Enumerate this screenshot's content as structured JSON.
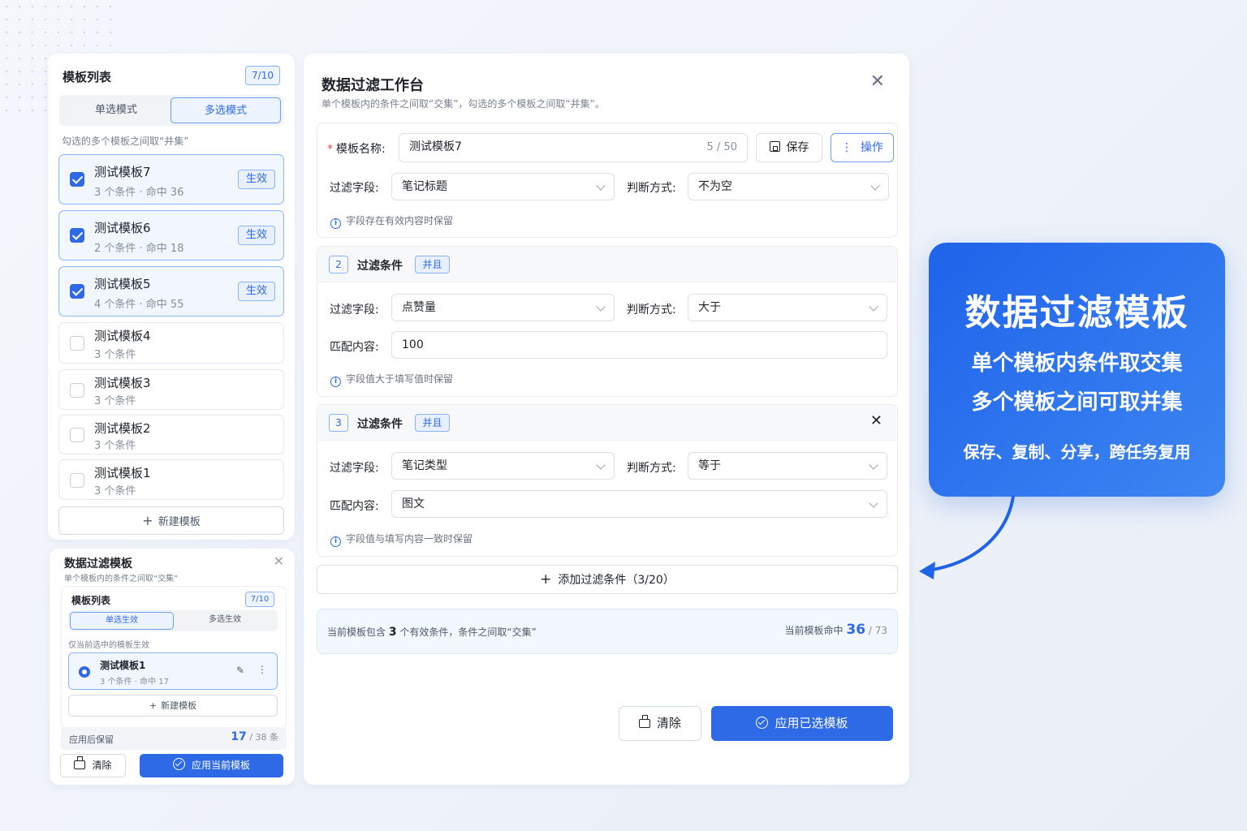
{
  "left_panel": {
    "title": "模板列表",
    "count": "7/10",
    "mode_single": "单选模式",
    "mode_multi": "多选模式",
    "hint": "勾选的多个模板之间取“并集”",
    "effective_label": "生效",
    "items": [
      {
        "name": "测试模板7",
        "meta": "3 个条件 · 命中 36",
        "checked": true
      },
      {
        "name": "测试模板6",
        "meta": "2 个条件 · 命中 18",
        "checked": true
      },
      {
        "name": "测试模板5",
        "meta": "4 个条件 · 命中 55",
        "checked": true
      },
      {
        "name": "测试模板4",
        "meta": "3 个条件",
        "checked": false
      },
      {
        "name": "测试模板3",
        "meta": "3 个条件",
        "checked": false
      },
      {
        "name": "测试模板2",
        "meta": "3 个条件",
        "checked": false
      },
      {
        "name": "测试模板1",
        "meta": "3 个条件",
        "checked": false
      }
    ],
    "new_template": "新建模板"
  },
  "mini_panel": {
    "title": "数据过滤模板",
    "subtitle": "单个模板内的条件之间取“交集”",
    "list_title": "模板列表",
    "count": "7/10",
    "mode_single": "单选生效",
    "mode_multi": "多选生效",
    "hint": "仅当前选中的模板生效",
    "item_name": "测试模板1",
    "item_meta": "3 个条件 · 命中 17",
    "new_template": "新建模板",
    "result_label": "应用后保留",
    "result_value": "17",
    "result_total": "/ 38 条",
    "clear": "清除",
    "apply": "应用当前模板"
  },
  "main_panel": {
    "title": "数据过滤工作台",
    "subtitle": "单个模板内的条件之间取“交集”，勾选的多个模板之间取“并集”。",
    "name_label": "模板名称:",
    "name_value": "测试模板7",
    "name_counter": "5 / 50",
    "save": "保存",
    "ops": "操作",
    "field_label": "过滤字段:",
    "method_label": "判断方式:",
    "match_label": "匹配内容:",
    "cond_title": "过滤条件",
    "and_label": "并且",
    "conditions": [
      {
        "field": "笔记标题",
        "method": "不为空",
        "tip": "字段存在有效内容时保留"
      },
      {
        "num": "2",
        "field": "点赞量",
        "method": "大于",
        "match": "100",
        "tip": "字段值大于填写值时保留"
      },
      {
        "num": "3",
        "field": "笔记类型",
        "method": "等于",
        "match": "图文",
        "tip": "字段值与填写内容一致时保留"
      }
    ],
    "add_condition": "添加过滤条件（3/20）",
    "summary_prefix": "当前模板包含",
    "summary_count": "3",
    "summary_suffix": "个有效条件，条件之间取“交集”",
    "hit_label": "当前模板命中",
    "hit_value": "36",
    "hit_total": "/ 73",
    "clear": "清除",
    "apply": "应用已选模板"
  },
  "promo": {
    "title": "数据过滤模板",
    "line1": "单个模板内条件取交集",
    "line2": "多个模板之间可取并集",
    "line3": "保存、复制、分享，跨任务复用"
  },
  "colors": {
    "accent": "#2f6ae6",
    "promo_start": "#1f63ea",
    "promo_end": "#3d86f2"
  }
}
